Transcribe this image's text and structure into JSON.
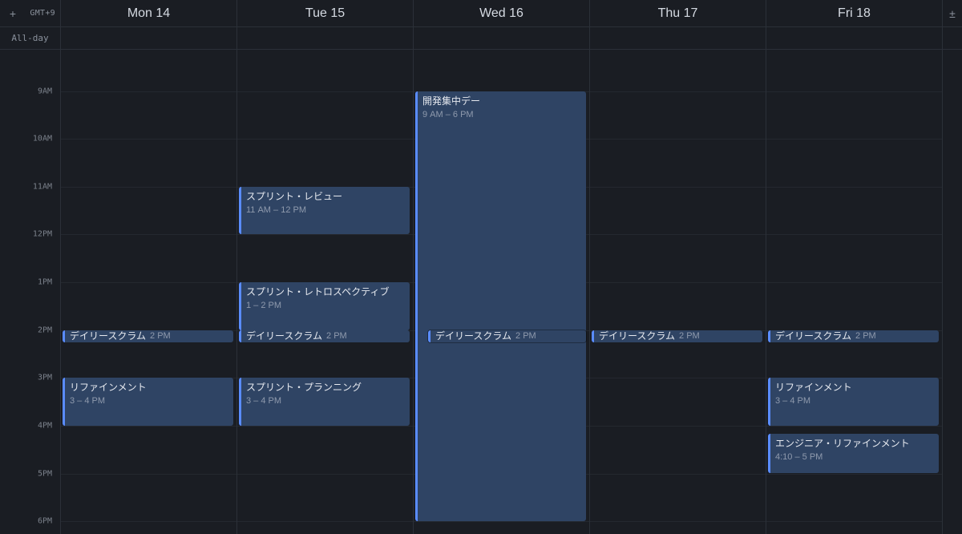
{
  "timezone": "GMT+9",
  "alldayLabel": "All-day",
  "days": [
    {
      "label": "Mon 14"
    },
    {
      "label": "Tue 15"
    },
    {
      "label": "Wed 16"
    },
    {
      "label": "Thu 17"
    },
    {
      "label": "Fri 18"
    }
  ],
  "hourLabels": [
    "9AM",
    "10AM",
    "11AM",
    "12PM",
    "1PM",
    "2PM",
    "3PM",
    "4PM",
    "5PM",
    "6PM"
  ],
  "gridStartMin": 488,
  "gridEndMin": 1096,
  "events": {
    "mon": [
      {
        "title": "デイリースクラム",
        "time": "2 PM",
        "startMin": 840,
        "endMin": 855,
        "short": true
      },
      {
        "title": "リファインメント",
        "time": "3 – 4 PM",
        "startMin": 900,
        "endMin": 960
      }
    ],
    "tue": [
      {
        "title": "スプリント・レビュー",
        "time": "11 AM – 12 PM",
        "startMin": 660,
        "endMin": 720
      },
      {
        "title": "スプリント・レトロスペクティブ",
        "time": "1 – 2 PM",
        "startMin": 780,
        "endMin": 840
      },
      {
        "title": "デイリースクラム",
        "time": "2 PM",
        "startMin": 840,
        "endMin": 855,
        "short": true
      },
      {
        "title": "スプリント・プランニング",
        "time": "3 – 4 PM",
        "startMin": 900,
        "endMin": 960
      }
    ],
    "wed": [
      {
        "title": "開発集中デー",
        "time": "9 AM – 6 PM",
        "startMin": 540,
        "endMin": 1080
      },
      {
        "title": "デイリースクラム",
        "time": "2 PM",
        "startMin": 840,
        "endMin": 855,
        "short": true,
        "overlay": true
      }
    ],
    "thu": [
      {
        "title": "デイリースクラム",
        "time": "2 PM",
        "startMin": 840,
        "endMin": 855,
        "short": true
      }
    ],
    "fri": [
      {
        "title": "デイリースクラム",
        "time": "2 PM",
        "startMin": 840,
        "endMin": 855,
        "short": true
      },
      {
        "title": "リファインメント",
        "time": "3 – 4 PM",
        "startMin": 900,
        "endMin": 960
      },
      {
        "title": "エンジニア・リファインメント",
        "time": "4:10 – 5 PM",
        "startMin": 970,
        "endMin": 1020
      }
    ]
  }
}
